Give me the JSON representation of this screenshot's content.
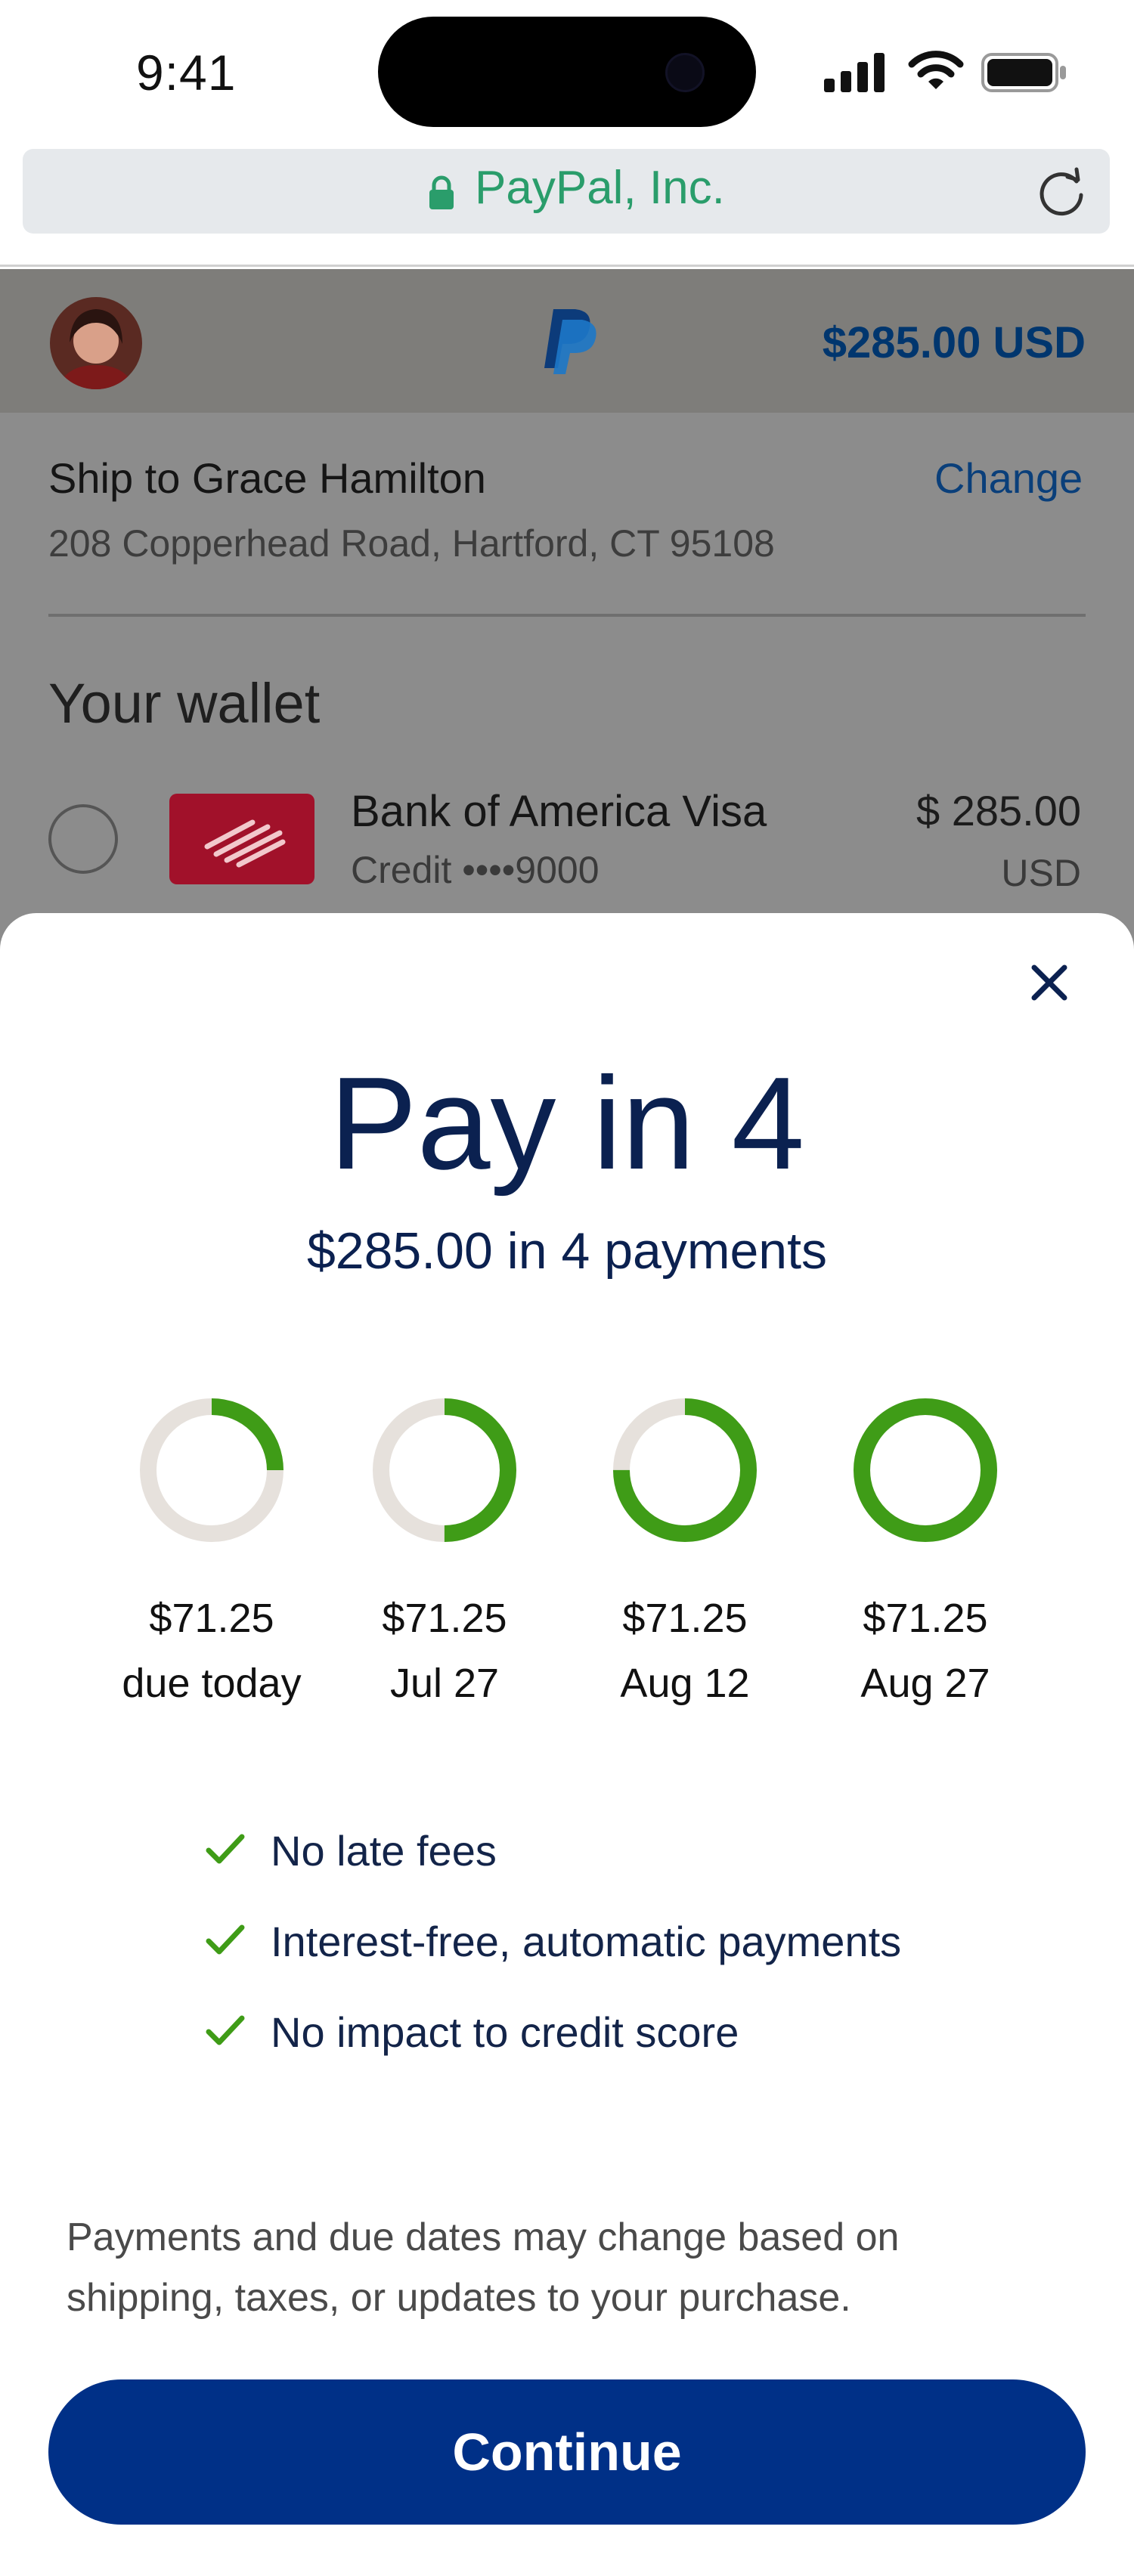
{
  "status_bar": {
    "time": "9:41"
  },
  "browser": {
    "url_text": "PayPal, Inc."
  },
  "header": {
    "amount": "$285.00 USD"
  },
  "shipping": {
    "label": "Ship to Grace Hamilton",
    "change": "Change",
    "address": "208 Copperhead Road, Hartford, CT 95108"
  },
  "wallet": {
    "title": "Your wallet",
    "card": {
      "name": "Bank of America Visa",
      "sub": "Credit ••••9000",
      "amount": "$ 285.00",
      "currency": "USD"
    }
  },
  "sheet": {
    "title": "Pay in 4",
    "subtitle": "$285.00 in 4 payments",
    "payments": [
      {
        "amount": "$71.25",
        "date": "due today",
        "progress": 0.25
      },
      {
        "amount": "$71.25",
        "date": "Jul 27",
        "progress": 0.5
      },
      {
        "amount": "$71.25",
        "date": "Aug 12",
        "progress": 0.75
      },
      {
        "amount": "$71.25",
        "date": "Aug 27",
        "progress": 1.0
      }
    ],
    "benefits": [
      "No late fees",
      "Interest-free, automatic payments",
      "No impact to credit score"
    ],
    "disclaimer": "Payments and due dates may change based on shipping, taxes, or updates to your purchase.",
    "continue": "Continue"
  },
  "colors": {
    "progress": "#3f9c17",
    "track": "#e6e1dc",
    "primary": "#003087",
    "title": "#0b2150"
  },
  "icons": [
    "lock-icon",
    "reload-icon",
    "paypal-logo",
    "close-icon",
    "check-icon",
    "bank-of-america-logo"
  ]
}
